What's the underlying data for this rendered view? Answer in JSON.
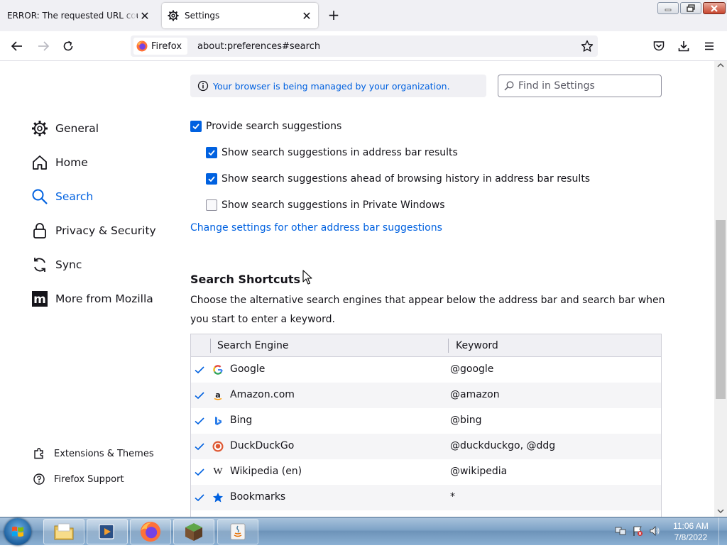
{
  "tabs": [
    {
      "title": "ERROR: The requested URL could not be retrieved",
      "active": false
    },
    {
      "title": "Settings",
      "active": true
    }
  ],
  "urlbar": {
    "identity_label": "Firefox",
    "url": "about:preferences#search"
  },
  "sidebar": {
    "categories": [
      {
        "label": "General",
        "icon": "gear-icon",
        "selected": false
      },
      {
        "label": "Home",
        "icon": "home-icon",
        "selected": false
      },
      {
        "label": "Search",
        "icon": "search-icon",
        "selected": true
      },
      {
        "label": "Privacy & Security",
        "icon": "lock-icon",
        "selected": false
      },
      {
        "label": "Sync",
        "icon": "sync-icon",
        "selected": false
      },
      {
        "label": "More from Mozilla",
        "icon": "mozilla-icon",
        "selected": false
      }
    ],
    "footer": [
      {
        "label": "Extensions & Themes",
        "icon": "puzzle-icon"
      },
      {
        "label": "Firefox Support",
        "icon": "help-icon"
      }
    ]
  },
  "policies_notice": "Your browser is being managed by your organization.",
  "find_placeholder": "Find in Settings",
  "suggestions": {
    "main": {
      "label": "Provide search suggestions",
      "checked": true
    },
    "options": [
      {
        "label": "Show search suggestions in address bar results",
        "checked": true
      },
      {
        "label": "Show search suggestions ahead of browsing history in address bar results",
        "checked": true
      },
      {
        "label": "Show search suggestions in Private Windows",
        "checked": false
      }
    ],
    "link": "Change settings for other address bar suggestions"
  },
  "shortcuts": {
    "title": "Search Shortcuts",
    "description": "Choose the alternative search engines that appear below the address bar and search bar when you start to enter a keyword.",
    "columns": [
      "Search Engine",
      "Keyword"
    ],
    "engines": [
      {
        "name": "Google",
        "keyword": "@google",
        "icon": "google-icon"
      },
      {
        "name": "Amazon.com",
        "keyword": "@amazon",
        "icon": "amazon-icon"
      },
      {
        "name": "Bing",
        "keyword": "@bing",
        "icon": "bing-icon"
      },
      {
        "name": "DuckDuckGo",
        "keyword": "@duckduckgo, @ddg",
        "icon": "duckduckgo-icon"
      },
      {
        "name": "Wikipedia (en)",
        "keyword": "@wikipedia",
        "icon": "wikipedia-icon"
      },
      {
        "name": "Bookmarks",
        "keyword": "*",
        "icon": "star-icon"
      }
    ]
  },
  "taskbar": {
    "time": "11:06 AM",
    "date": "7/8/2022"
  },
  "colors": {
    "accent": "#0061e0",
    "tabstrip": "#f0f0f4"
  }
}
